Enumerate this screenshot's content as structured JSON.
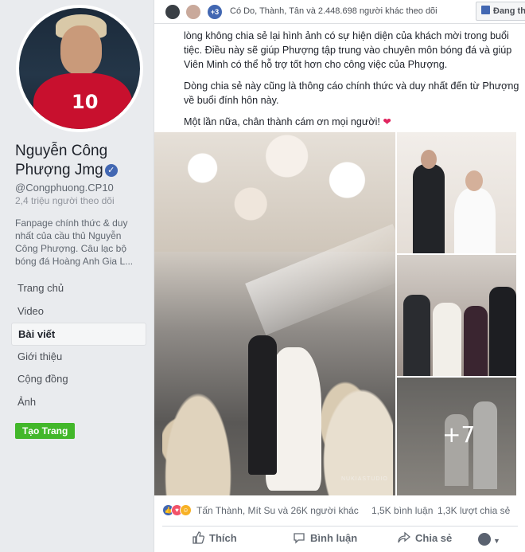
{
  "sidebar": {
    "page_name": "Nguyễn Công Phượng Jmg",
    "handle": "@Congphuong.CP10",
    "followers": "2,4 triệu người theo dõi",
    "description": "Fanpage chính thức & duy nhất của cầu thủ Nguyễn Công Phượng. Câu lạc bộ bóng đá Hoàng Anh Gia L...",
    "jersey_number": "10",
    "nav": [
      {
        "label": "Trang chủ",
        "active": false
      },
      {
        "label": "Video",
        "active": false
      },
      {
        "label": "Bài viết",
        "active": true
      },
      {
        "label": "Giới thiệu",
        "active": false
      },
      {
        "label": "Cộng đồng",
        "active": false
      },
      {
        "label": "Ảnh",
        "active": false
      }
    ],
    "create_page_button": "Tạo Trang"
  },
  "topbar": {
    "extra_count": "+3",
    "liked_text": "Có Do, Thành, Tân và 2.448.698 người khác theo dõi",
    "follow_button": "Đang th"
  },
  "post": {
    "paragraphs": [
      "lòng không chia sẻ lại hình ảnh có sự hiện diện của khách mời trong buổi tiệc. Điều này sẽ giúp Phượng tập trung vào chuyên môn bóng đá và giúp Viên Minh có thể hỗ trợ tốt hơn cho công việc của Phượng.",
      "Dòng chia sẻ này cũng là thông cáo chính thức và duy nhất đến từ Phượng về buổi đính hôn này.",
      "Một lần nữa, chân thành cám ơn mọi người!"
    ],
    "heart": "❤",
    "photo_watermark": "NUKIASTUDIO",
    "more_photos": "+7"
  },
  "reactions": {
    "names": "Tấn Thành, Mít Su và 26K người khác",
    "comments": "1,5K bình luận",
    "shares": "1,3K lượt chia sẻ"
  },
  "actions": {
    "like": "Thích",
    "comment": "Bình luận",
    "share": "Chia sẻ"
  },
  "colors": {
    "brand": "#4267b2",
    "create_button": "#42b72a",
    "love": "#f25268",
    "haha": "#f7b125"
  }
}
